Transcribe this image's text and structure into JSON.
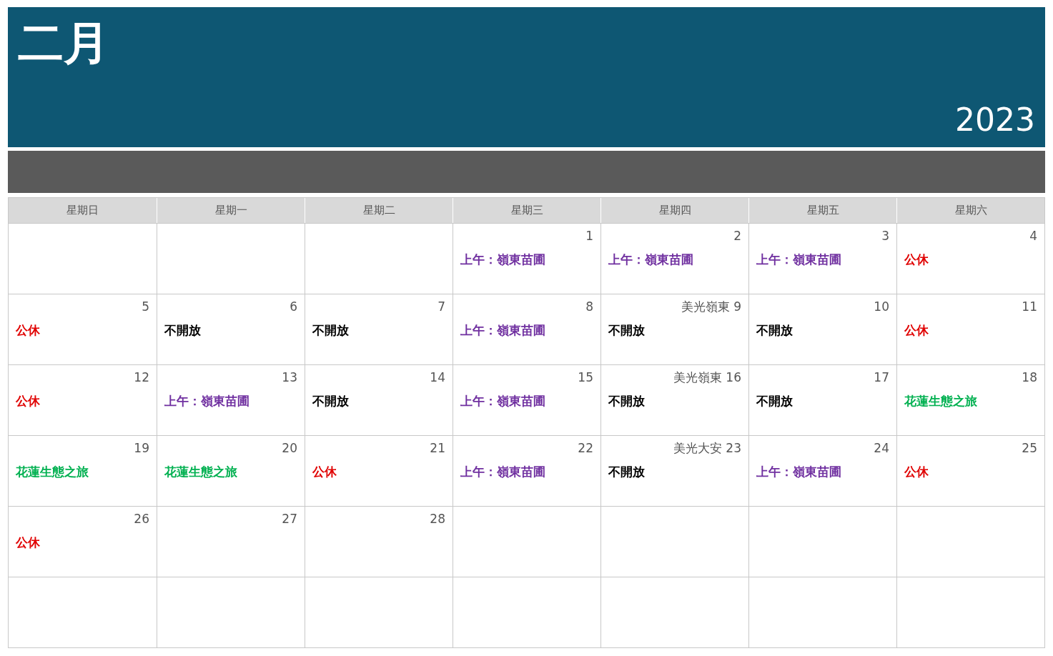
{
  "month": "二月",
  "year": "2023",
  "weekdays": [
    "星期日",
    "星期一",
    "星期二",
    "星期三",
    "星期四",
    "星期五",
    "星期六"
  ],
  "weeks": [
    [
      {
        "kind": "blank"
      },
      {
        "kind": "blank"
      },
      {
        "kind": "blank"
      },
      {
        "kind": "day",
        "day": "1",
        "event": {
          "text": "上午：嶺東苗圃",
          "color": "#7030a0"
        }
      },
      {
        "kind": "day",
        "day": "2",
        "event": {
          "text": "上午：嶺東苗圃",
          "color": "#7030a0"
        }
      },
      {
        "kind": "day",
        "day": "3",
        "event": {
          "text": "上午：嶺東苗圃",
          "color": "#7030a0"
        }
      },
      {
        "kind": "day",
        "day": "4",
        "event": {
          "text": "公休",
          "color": "#e00000"
        }
      }
    ],
    [
      {
        "kind": "day",
        "day": "5",
        "event": {
          "text": "公休",
          "color": "#e00000"
        }
      },
      {
        "kind": "day",
        "day": "6",
        "event": {
          "text": "不開放",
          "color": "#000000"
        }
      },
      {
        "kind": "day",
        "day": "7",
        "event": {
          "text": "不開放",
          "color": "#000000"
        }
      },
      {
        "kind": "day",
        "day": "8",
        "event": {
          "text": "上午：嶺東苗圃",
          "color": "#7030a0"
        }
      },
      {
        "kind": "day",
        "day": "美光嶺東 9",
        "event": {
          "text": "不開放",
          "color": "#000000"
        }
      },
      {
        "kind": "day",
        "day": "10",
        "event": {
          "text": "不開放",
          "color": "#000000"
        }
      },
      {
        "kind": "day",
        "day": "11",
        "event": {
          "text": "公休",
          "color": "#e00000"
        }
      }
    ],
    [
      {
        "kind": "day",
        "day": "12",
        "event": {
          "text": "公休",
          "color": "#e00000"
        }
      },
      {
        "kind": "day",
        "day": "13",
        "event": {
          "text": "上午：嶺東苗圃",
          "color": "#7030a0"
        }
      },
      {
        "kind": "day",
        "day": "14",
        "event": {
          "text": "不開放",
          "color": "#000000"
        }
      },
      {
        "kind": "day",
        "day": "15",
        "event": {
          "text": "上午：嶺東苗圃",
          "color": "#7030a0"
        }
      },
      {
        "kind": "day",
        "day": "美光嶺東 16",
        "event": {
          "text": "不開放",
          "color": "#000000"
        }
      },
      {
        "kind": "day",
        "day": "17",
        "event": {
          "text": "不開放",
          "color": "#000000"
        }
      },
      {
        "kind": "day",
        "day": "18",
        "event": {
          "text": "花蓮生態之旅",
          "color": "#00b050"
        }
      }
    ],
    [
      {
        "kind": "day",
        "day": "19",
        "event": {
          "text": "花蓮生態之旅",
          "color": "#00b050"
        }
      },
      {
        "kind": "day",
        "day": "20",
        "event": {
          "text": "花蓮生態之旅",
          "color": "#00b050"
        }
      },
      {
        "kind": "day",
        "day": "21",
        "event": {
          "text": "公休",
          "color": "#e00000"
        }
      },
      {
        "kind": "day",
        "day": "22",
        "event": {
          "text": "上午：嶺東苗圃",
          "color": "#7030a0"
        }
      },
      {
        "kind": "day",
        "day": "美光大安 23",
        "event": {
          "text": "不開放",
          "color": "#000000"
        }
      },
      {
        "kind": "day",
        "day": "24",
        "event": {
          "text": "上午：嶺東苗圃",
          "color": "#7030a0"
        }
      },
      {
        "kind": "day",
        "day": "25",
        "event": {
          "text": "公休",
          "color": "#e00000"
        }
      }
    ],
    [
      {
        "kind": "day",
        "day": "26",
        "event": {
          "text": "公休",
          "color": "#e00000"
        }
      },
      {
        "kind": "day",
        "day": "27"
      },
      {
        "kind": "day",
        "day": "28"
      },
      {
        "kind": "blank"
      },
      {
        "kind": "blank"
      },
      {
        "kind": "blank"
      },
      {
        "kind": "blank"
      }
    ],
    [
      {
        "kind": "blank"
      },
      {
        "kind": "blank"
      },
      {
        "kind": "blank"
      },
      {
        "kind": "blank"
      },
      {
        "kind": "blank"
      },
      {
        "kind": "blank"
      },
      {
        "kind": "blank"
      }
    ]
  ]
}
